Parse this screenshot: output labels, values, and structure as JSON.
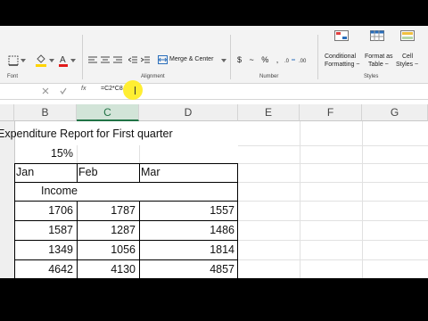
{
  "ribbon": {
    "font_group": "Font",
    "alignment_group": "Alignment",
    "number_group": "Number",
    "styles_group": "Styles",
    "merge_center": "Merge & Center",
    "number_format": "$ ~ % ,",
    "conditional_formatting_1": "Conditional",
    "conditional_formatting_2": "Formatting ~",
    "format_as_table_1": "Format as",
    "format_as_table_2": "Table ~",
    "cell_styles_1": "Cell",
    "cell_styles_2": "Styles ~"
  },
  "formula_bar": {
    "fx": "fx",
    "content": "=C2*C8"
  },
  "columns": [
    "B",
    "C",
    "D",
    "E",
    "F",
    "G"
  ],
  "selected_column": "C",
  "sheet": {
    "title": "Expenditure Report for First quarter",
    "rate": "15%",
    "months": [
      "Jan",
      "Feb",
      "Mar"
    ],
    "section": "Income",
    "rows": [
      [
        "1706",
        "1787",
        "1557"
      ],
      [
        "1587",
        "1287",
        "1486"
      ],
      [
        "1349",
        "1056",
        "1814"
      ],
      [
        "4642",
        "4130",
        "4857"
      ]
    ]
  },
  "colors": {
    "excel_green": "#217346",
    "selected_header": "#d2e4d8",
    "highlight": "#ffee33"
  }
}
